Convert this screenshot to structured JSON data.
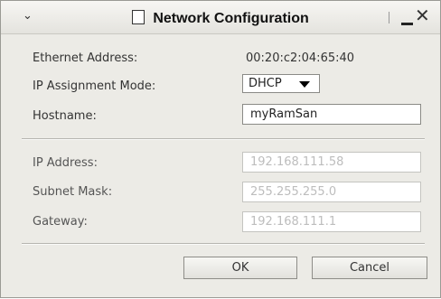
{
  "window": {
    "title": "Network Configuration",
    "menu_icon": "chevron-down-icon",
    "doc_icon": "document-icon",
    "min_icon": "minimize-icon",
    "close_icon": "close-icon"
  },
  "form": {
    "ethernet_label": "Ethernet Address:",
    "ethernet_value": "00:20:c2:04:65:40",
    "ip_mode_label": "IP Assignment Mode:",
    "ip_mode_value": "DHCP",
    "hostname_label": "Hostname:",
    "hostname_value": "myRamSan",
    "ip_label": "IP Address:",
    "ip_value": "192.168.111.58",
    "subnet_label": "Subnet Mask:",
    "subnet_value": "255.255.255.0",
    "gateway_label": "Gateway:",
    "gateway_value": "192.168.111.1"
  },
  "buttons": {
    "ok": "OK",
    "cancel": "Cancel"
  }
}
